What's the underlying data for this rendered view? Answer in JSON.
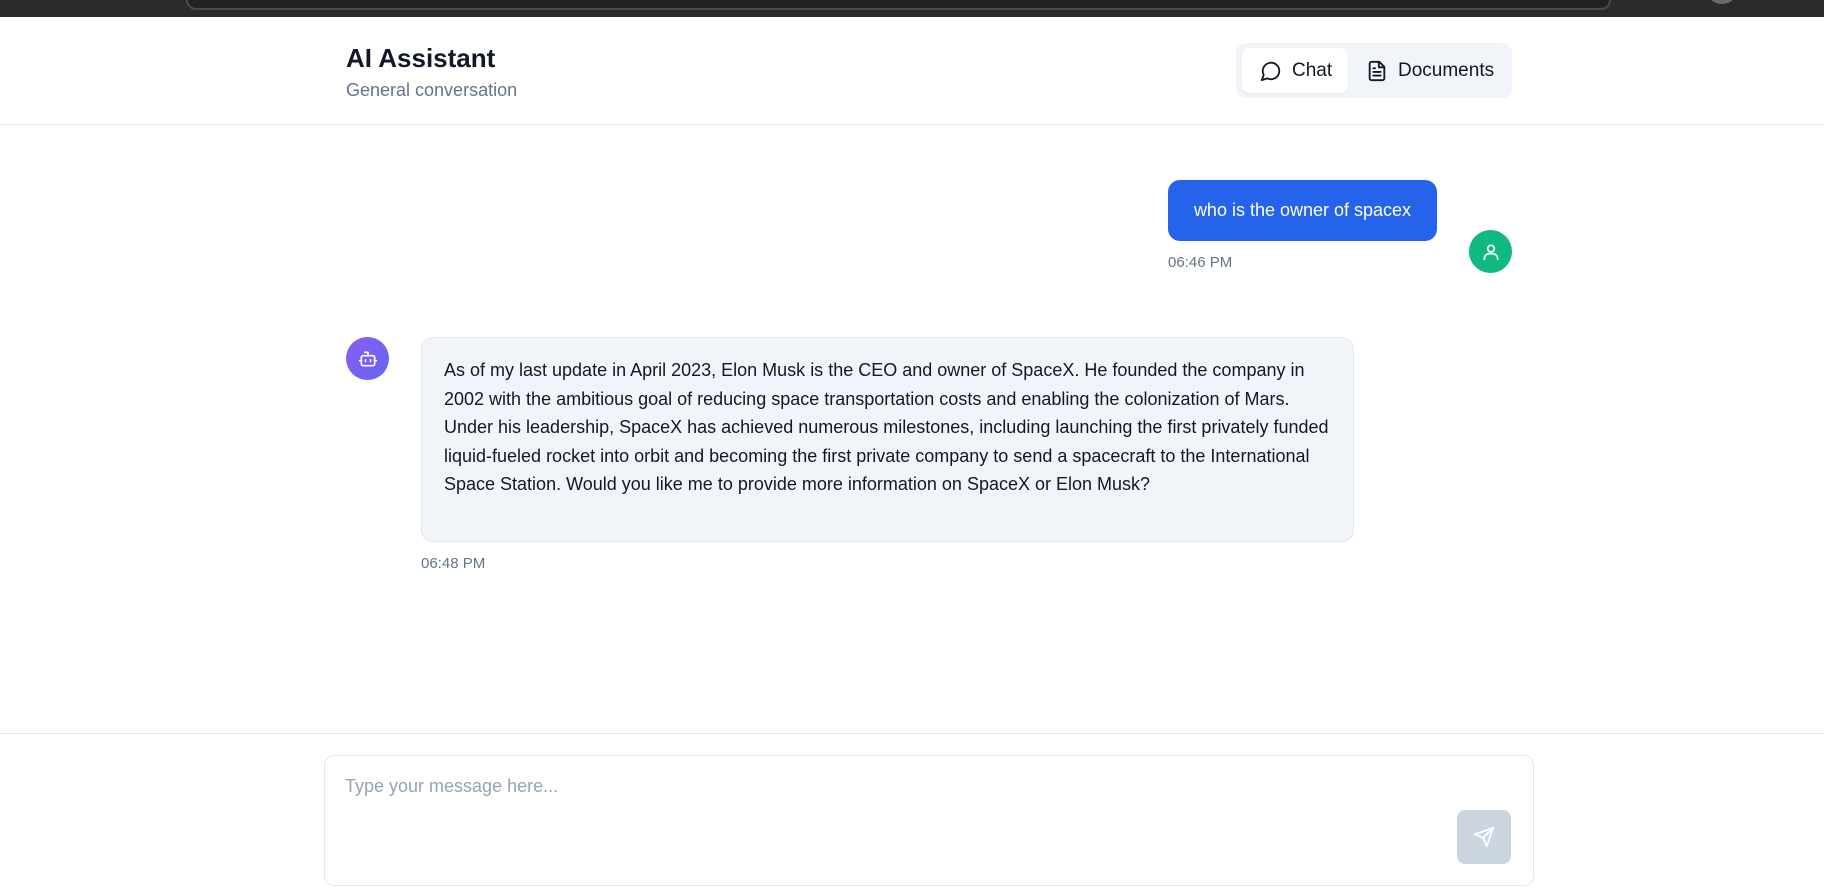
{
  "header": {
    "title": "AI Assistant",
    "subtitle": "General conversation",
    "tabs": [
      {
        "label": "Chat",
        "icon": "message-circle-icon",
        "active": true
      },
      {
        "label": "Documents",
        "icon": "file-text-icon",
        "active": false
      }
    ]
  },
  "messages": [
    {
      "role": "user",
      "text": "who is the owner of spacex",
      "time": "06:46 PM",
      "avatar_icon": "user-icon"
    },
    {
      "role": "assistant",
      "text": "As of my last update in April 2023, Elon Musk is the CEO and owner of SpaceX. He founded the company in 2002 with the ambitious goal of reducing space transportation costs and enabling the colonization of Mars. Under his leadership, SpaceX has achieved numerous milestones, including launching the first privately funded liquid-fueled rocket into orbit and becoming the first private company to send a spacecraft to the International Space Station. Would you like me to provide more information on SpaceX or Elon Musk?",
      "time": "06:48 PM",
      "avatar_icon": "bot-icon"
    }
  ],
  "composer": {
    "placeholder": "Type your message here...",
    "value": "",
    "send_icon": "send-icon"
  },
  "colors": {
    "user_bubble": "#2563eb",
    "user_avatar": "#10b981",
    "bot_avatar": "#8b5cf6",
    "bot_bubble": "#f1f5f9",
    "send_button_disabled": "#cbd5e1"
  }
}
